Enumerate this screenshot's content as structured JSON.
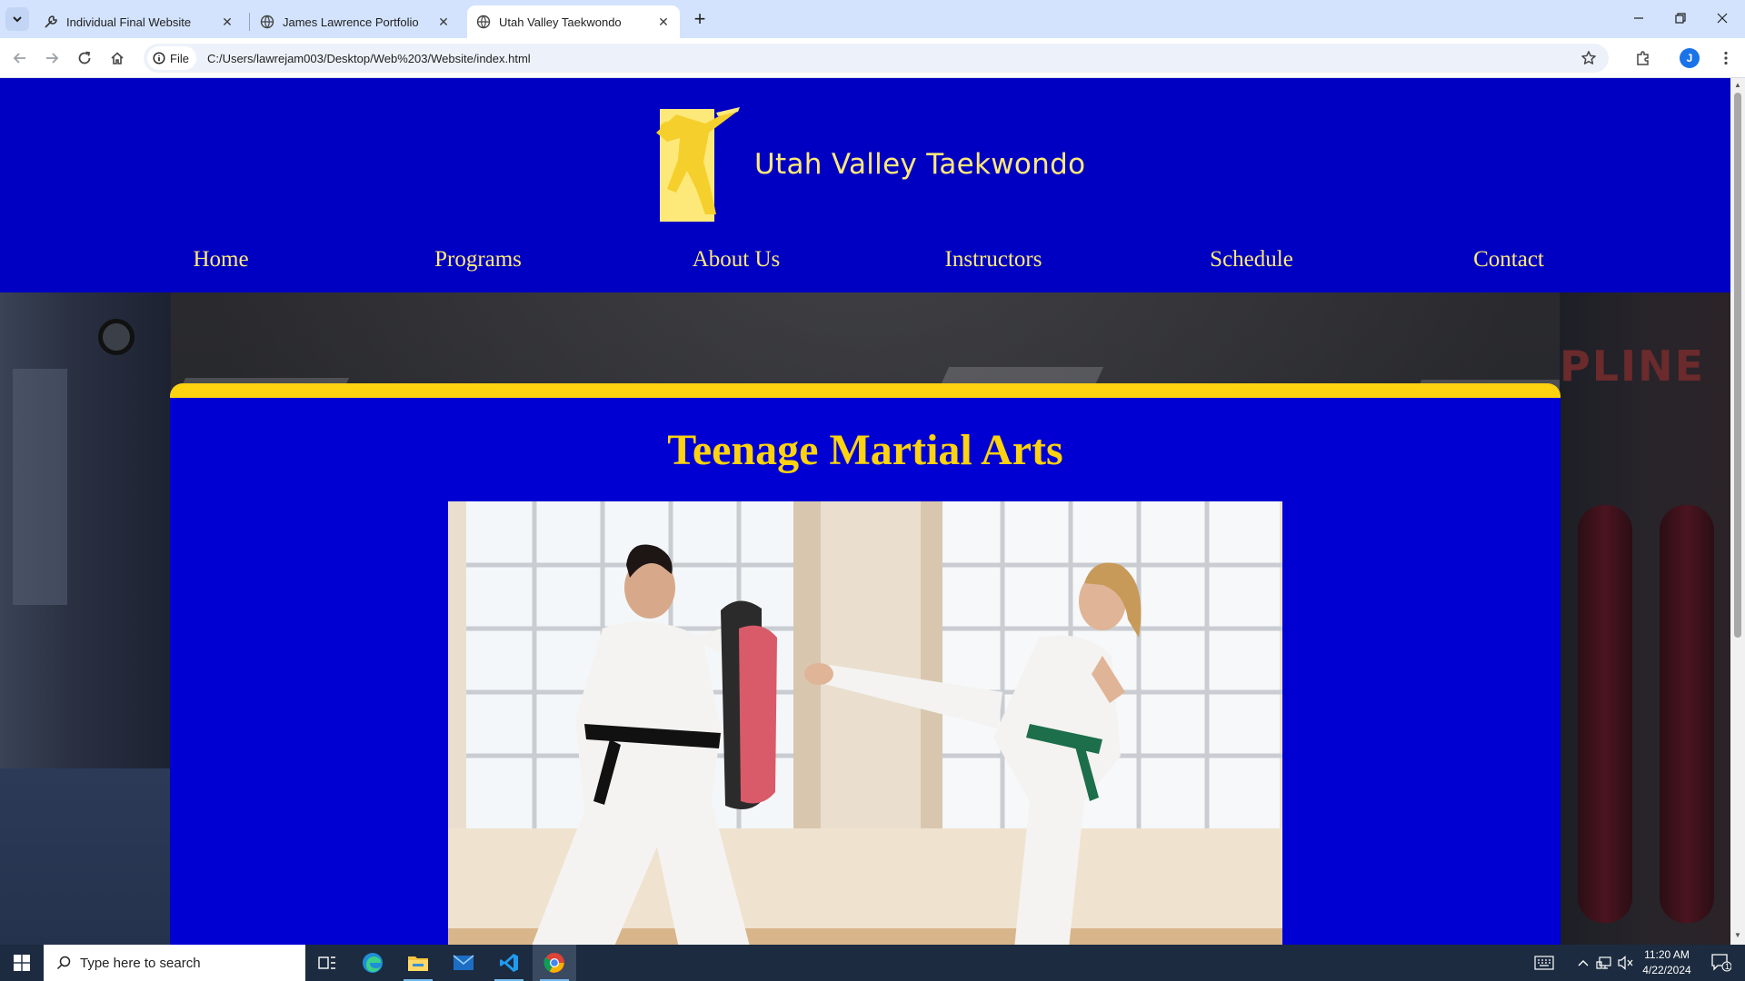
{
  "browser": {
    "tabs": [
      {
        "title": "Individual Final Website",
        "active": false
      },
      {
        "title": "James Lawrence Portfolio",
        "active": false
      },
      {
        "title": "Utah Valley Taekwondo",
        "active": true
      }
    ],
    "omnibox": {
      "scheme_chip": "File",
      "url": "C:/Users/lawrejam003/Desktop/Web%203/Website/index.html"
    },
    "profile_initial": "J"
  },
  "site": {
    "logo_text": "Utah Valley Taekwondo",
    "nav": [
      "Home",
      "Programs",
      "About Us",
      "Instructors",
      "Schedule",
      "Contact"
    ],
    "section_title": "Teenage Martial Arts",
    "background_wall_text": "PLINE",
    "colors": {
      "header_blue": "#0000c2",
      "card_blue": "#0000d2",
      "accent_yellow": "#fdd20e",
      "link_yellow": "#fde97a"
    }
  },
  "taskbar": {
    "search_placeholder": "Type here to search",
    "time": "11:20 AM",
    "date": "4/22/2024",
    "notification_count": "1",
    "apps": [
      "task-view",
      "edge",
      "file-explorer",
      "mail",
      "vscode",
      "chrome"
    ]
  }
}
